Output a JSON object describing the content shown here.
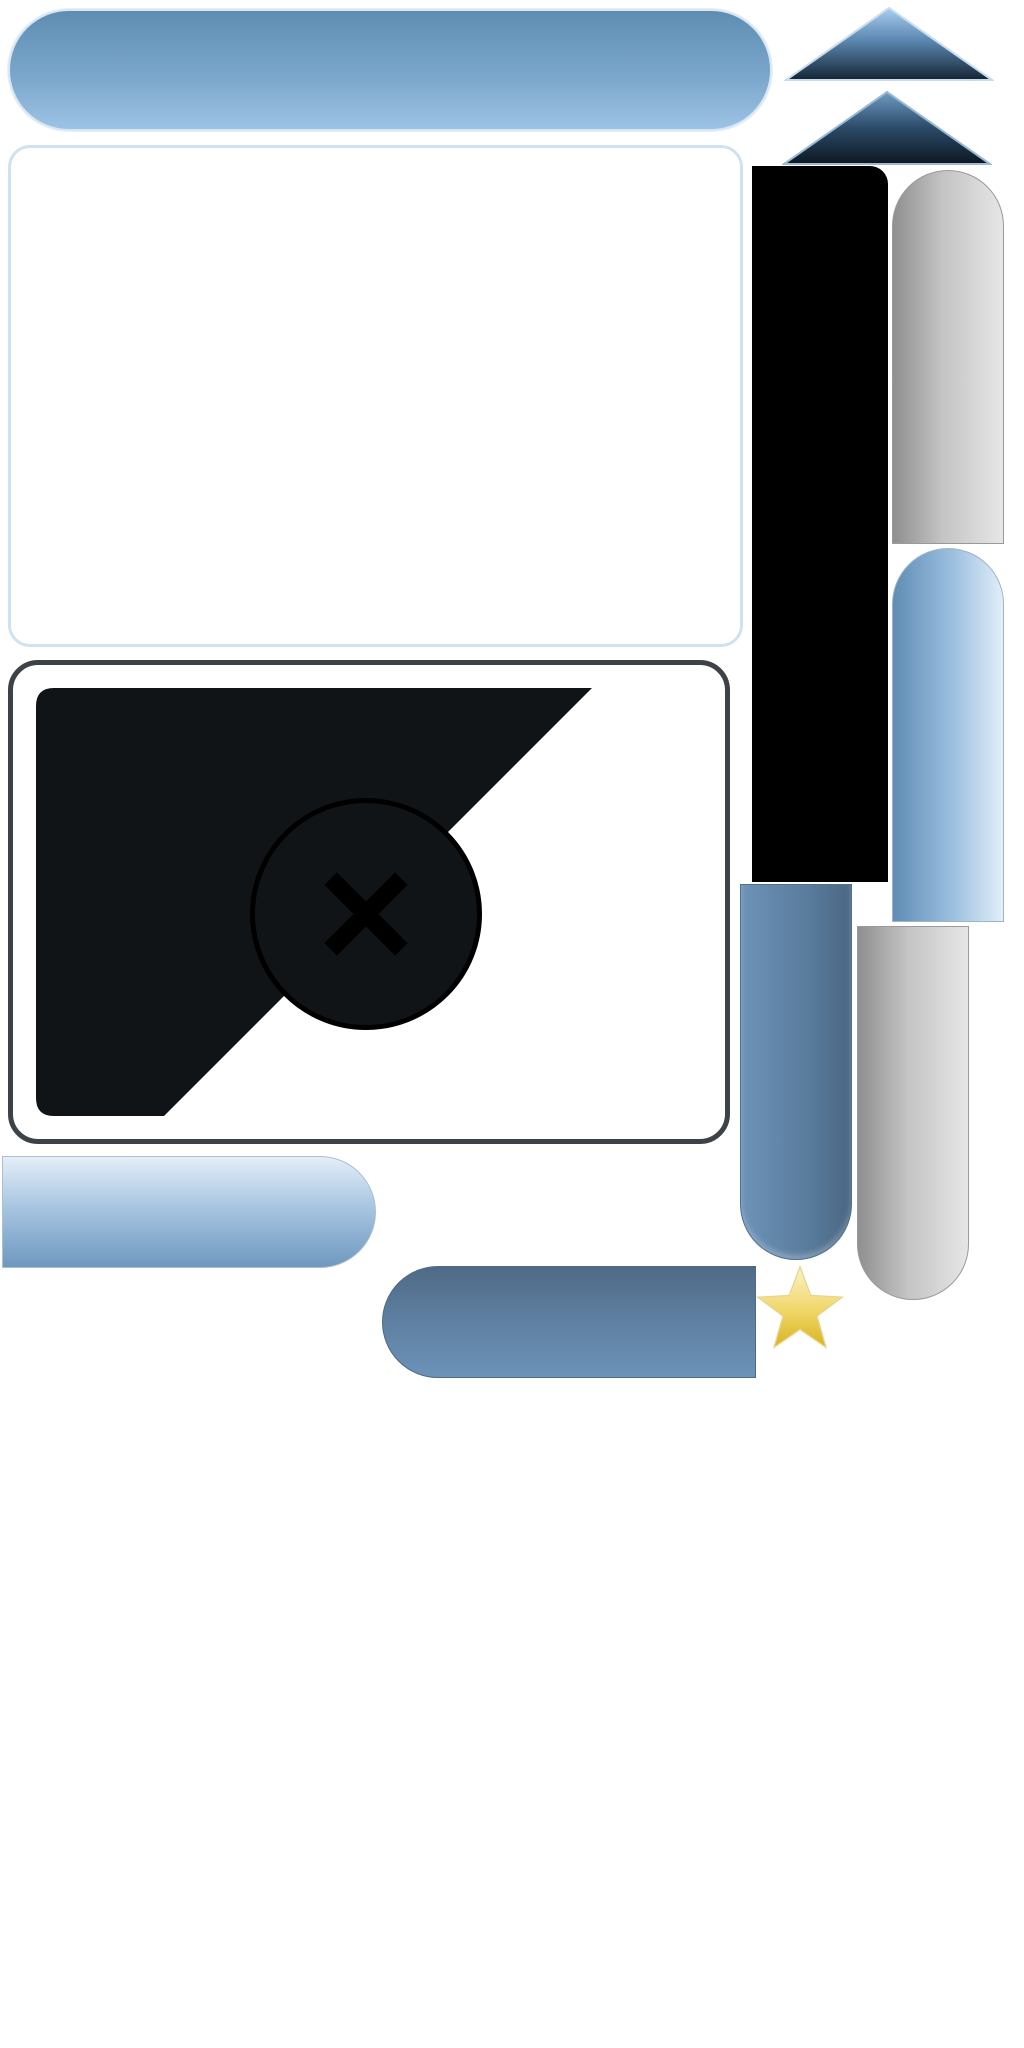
{
  "theme": {
    "accent_blue": "#7aa6cb",
    "dark_blue": "#5a7c9d",
    "light_blue_border": "#cfe2f2",
    "dialog_border": "#3c4248",
    "dialog_fill": "#111416",
    "gray": "#c4c4c4",
    "star_yellow": "#e6c53a"
  },
  "icons": {
    "close": "close-icon",
    "star": "star-icon",
    "triangle_up": "triangle-up-icon"
  }
}
